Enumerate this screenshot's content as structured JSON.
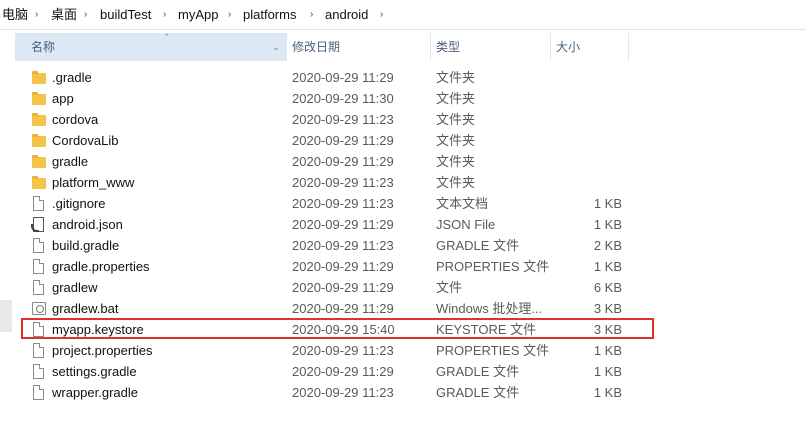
{
  "breadcrumb": [
    {
      "label": "电脑"
    },
    {
      "label": "桌面"
    },
    {
      "label": "buildTest"
    },
    {
      "label": "myApp"
    },
    {
      "label": "platforms"
    },
    {
      "label": "android"
    }
  ],
  "separator_glyph": "›",
  "columns": {
    "name": "名称",
    "date": "修改日期",
    "type": "类型",
    "size": "大小",
    "sort_indicator": "ˆ",
    "dropdown_glyph": "⌄"
  },
  "files": [
    {
      "name": ".gradle",
      "date": "2020-09-29 11:29",
      "type": "文件夹",
      "size": "",
      "icon": "folder-icon"
    },
    {
      "name": "app",
      "date": "2020-09-29 11:30",
      "type": "文件夹",
      "size": "",
      "icon": "folder-icon"
    },
    {
      "name": "cordova",
      "date": "2020-09-29 11:23",
      "type": "文件夹",
      "size": "",
      "icon": "folder-icon"
    },
    {
      "name": "CordovaLib",
      "date": "2020-09-29 11:29",
      "type": "文件夹",
      "size": "",
      "icon": "folder-icon"
    },
    {
      "name": "gradle",
      "date": "2020-09-29 11:29",
      "type": "文件夹",
      "size": "",
      "icon": "folder-icon"
    },
    {
      "name": "platform_www",
      "date": "2020-09-29 11:23",
      "type": "文件夹",
      "size": "",
      "icon": "folder-icon"
    },
    {
      "name": ".gitignore",
      "date": "2020-09-29 11:23",
      "type": "文本文档",
      "size": "1 KB",
      "icon": "file-icon"
    },
    {
      "name": "android.json",
      "date": "2020-09-29 11:29",
      "type": "JSON File",
      "size": "1 KB",
      "icon": "json-file-icon"
    },
    {
      "name": "build.gradle",
      "date": "2020-09-29 11:23",
      "type": "GRADLE 文件",
      "size": "2 KB",
      "icon": "file-icon"
    },
    {
      "name": "gradle.properties",
      "date": "2020-09-29 11:29",
      "type": "PROPERTIES 文件",
      "size": "1 KB",
      "icon": "file-icon"
    },
    {
      "name": "gradlew",
      "date": "2020-09-29 11:29",
      "type": "文件",
      "size": "6 KB",
      "icon": "file-icon"
    },
    {
      "name": "gradlew.bat",
      "date": "2020-09-29 11:29",
      "type": "Windows 批处理...",
      "size": "3 KB",
      "icon": "batch-file-icon"
    },
    {
      "name": "myapp.keystore",
      "date": "2020-09-29 15:40",
      "type": "KEYSTORE 文件",
      "size": "3 KB",
      "icon": "file-icon"
    },
    {
      "name": "project.properties",
      "date": "2020-09-29 11:23",
      "type": "PROPERTIES 文件",
      "size": "1 KB",
      "icon": "file-icon"
    },
    {
      "name": "settings.gradle",
      "date": "2020-09-29 11:29",
      "type": "GRADLE 文件",
      "size": "1 KB",
      "icon": "file-icon"
    },
    {
      "name": "wrapper.gradle",
      "date": "2020-09-29 11:23",
      "type": "GRADLE 文件",
      "size": "1 KB",
      "icon": "file-icon"
    }
  ],
  "highlighted_file": "myapp.keystore",
  "colors": {
    "highlight_border": "#e03131",
    "folder": "#f5c347",
    "header_selected": "#dde8f5"
  }
}
